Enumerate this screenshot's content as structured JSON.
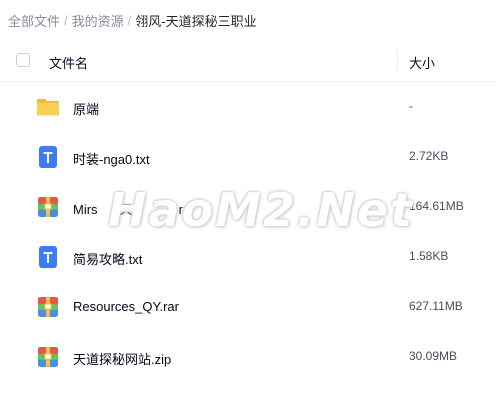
{
  "breadcrumb": {
    "items": [
      "全部文件",
      "我的资源",
      "翎风-天道探秘三职业"
    ],
    "separator": "/"
  },
  "table": {
    "header": {
      "name": "文件名",
      "size": "大小"
    }
  },
  "files": [
    {
      "name": "原端",
      "size": "-",
      "icon": "folder-icon"
    },
    {
      "name": "时装-nga0.txt",
      "size": "2.72KB",
      "icon": "text-file-icon"
    },
    {
      "name": "Mirs",
      "name_rest": "天",
      "name_tail": "r",
      "size": "164.61MB",
      "icon": "archive-icon"
    },
    {
      "name": "简易攻略.txt",
      "size": "1.58KB",
      "icon": "text-file-icon"
    },
    {
      "name": "Resources_QY.rar",
      "size": "627.11MB",
      "icon": "archive-icon"
    },
    {
      "name": "天道探秘网站.zip",
      "size": "30.09MB",
      "icon": "archive-icon"
    }
  ],
  "watermark": {
    "text": "HaoM2.Net"
  },
  "colors": {
    "folder": "#f7c544",
    "text_file": "#3b82f6",
    "archive_top": "#e8564c",
    "archive_mid": "#6abf55",
    "archive_bottom": "#4a90e2"
  }
}
